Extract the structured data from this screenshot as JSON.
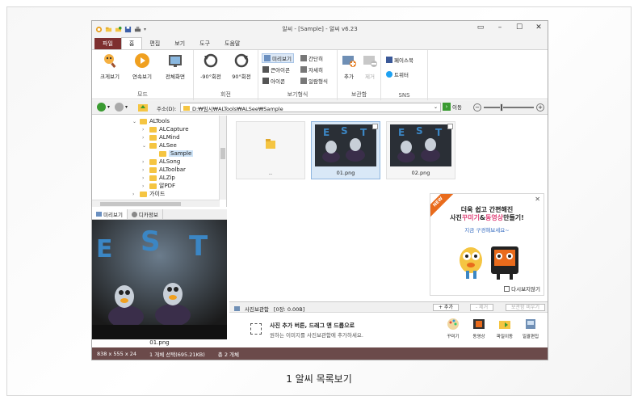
{
  "window": {
    "title": "알씨 - [Sample] - 알씨 v6.23"
  },
  "ribbon_tabs": [
    "파일",
    "홈",
    "편집",
    "보기",
    "도구",
    "도움말"
  ],
  "ribbon": {
    "groups": {
      "mode": "모드",
      "rotate": "회전",
      "view_style": "보기형식",
      "album": "보관함",
      "sns": "SNS"
    },
    "buttons": {
      "large_view": "크게보기",
      "slideshow": "연속보기",
      "fullscreen": "전체화면",
      "rotate_left": "-90°회전",
      "rotate_right": "90°회전",
      "preview": "미리보기",
      "large_icon": "큰아이콘",
      "icon": "아이콘",
      "simple": "간단히",
      "detail": "자세히",
      "list": "일람형식",
      "add": "추가",
      "remove": "제거",
      "facebook": "페이스북",
      "twitter": "트위터"
    }
  },
  "address": {
    "label": "주소(D):",
    "path": "D:₩임시₩ALTools₩ALSee₩Sample",
    "go": "이동"
  },
  "tree": {
    "items": [
      {
        "label": "ALTools",
        "arrow": "⌄"
      },
      {
        "label": "ALCapture",
        "arrow": "›"
      },
      {
        "label": "ALMind",
        "arrow": "›"
      },
      {
        "label": "ALSee",
        "arrow": "⌄"
      },
      {
        "label": "Sample",
        "arrow": ""
      },
      {
        "label": "ALSong",
        "arrow": "›"
      },
      {
        "label": "ALToolbar",
        "arrow": "›"
      },
      {
        "label": "ALZip",
        "arrow": "›"
      },
      {
        "label": "알PDF",
        "arrow": "›"
      },
      {
        "label": "가이드",
        "arrow": "›"
      }
    ]
  },
  "preview_tabs": [
    "미리보기",
    "디카정보"
  ],
  "preview": {
    "filename": "01.png"
  },
  "files": [
    {
      "name": ".."
    },
    {
      "name": "01.png"
    },
    {
      "name": "02.png"
    }
  ],
  "ad": {
    "badge": "NEW",
    "line1": "더욱 쉽고 간편해진",
    "line2_pre": "사진",
    "line2_hl1": "꾸미기",
    "line2_mid": "&",
    "line2_hl2": "동영상",
    "line2_post": "만들기!",
    "sub": "지금 구경해보세요~",
    "dont_show": "다시보지않기"
  },
  "album": {
    "title": "사진보관함",
    "count": "[0장: 0.00B]",
    "add": "+ 추가",
    "remove": "- 제거",
    "delete_all": "보관함 비우기",
    "drop_title": "사진 추가 버튼, 드래그 앤 드롭으로",
    "drop_sub": "원하는 이미지를 사진보관함에 추가하세요.",
    "actions": [
      "꾸미기",
      "동영상",
      "파일이동",
      "일괄편집"
    ]
  },
  "status": {
    "dimensions": "838 x 555 x 24",
    "selection": "1 개체 선택(695.21KB)",
    "total": "총 2 개체"
  },
  "caption": "1 알씨 목록보기",
  "colors": {
    "file_tab": "#7e2f2f",
    "statusbar": "#6b4a4a",
    "selection": "#d9e8f7",
    "ad_accent": "#e0447a"
  }
}
